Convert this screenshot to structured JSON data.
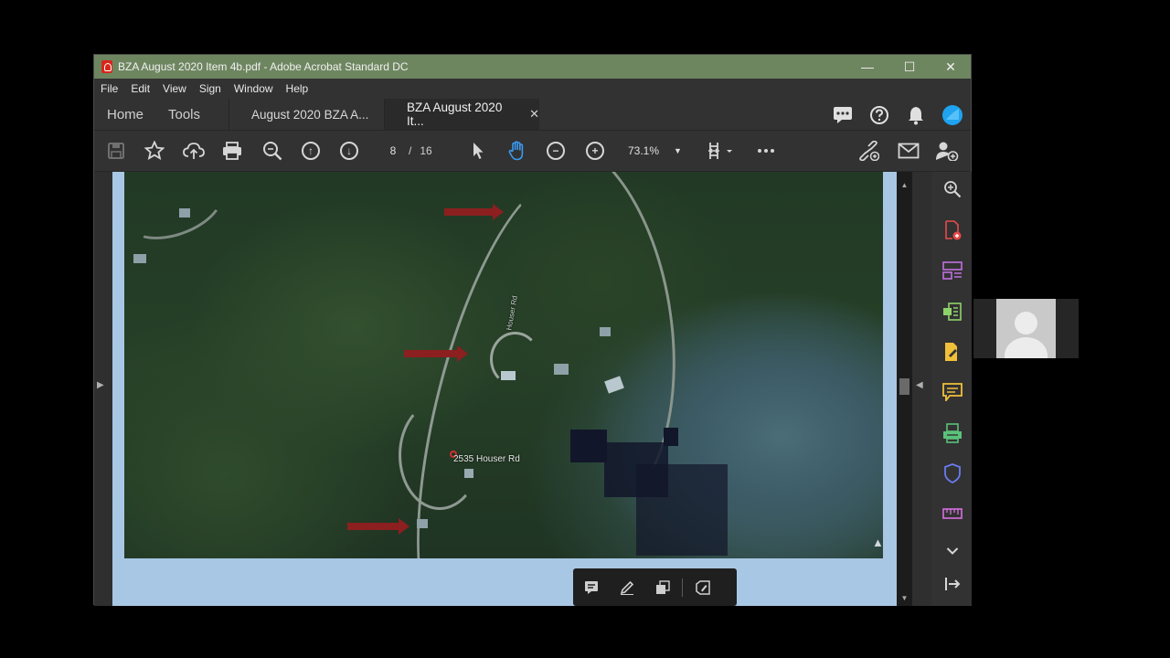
{
  "window": {
    "title": "BZA August 2020 Item 4b.pdf - Adobe Acrobat Standard DC",
    "controls": {
      "minimize": "—",
      "maximize": "☐",
      "close": "✕"
    }
  },
  "menu": [
    "File",
    "Edit",
    "View",
    "Sign",
    "Window",
    "Help"
  ],
  "tabs": {
    "home": "Home",
    "tools": "Tools",
    "documents": [
      {
        "label": "August 2020 BZA A...",
        "active": false
      },
      {
        "label": "BZA August 2020 It...",
        "active": true,
        "close": "✕"
      }
    ]
  },
  "toolbar": {
    "current_page": "8",
    "page_separator": "/",
    "total_pages": "16",
    "zoom": "73.1%"
  },
  "map": {
    "address_label": "2535 Houser Rd",
    "road_label": "Houser Rd"
  },
  "icons": {
    "save": "save-icon",
    "bookmark": "star-icon",
    "upload": "upload-cloud-icon",
    "print": "print-icon",
    "zoom_search": "search-zoom-icon",
    "prev_page": "arrow-up-circle-icon",
    "next_page": "arrow-down-circle-icon",
    "select": "pointer-icon",
    "hand": "hand-icon",
    "zoom_out": "minus-circle-icon",
    "zoom_in": "plus-circle-icon"
  },
  "colors": {
    "titlebar": "#6e8660",
    "accent_blue": "#3a9af0",
    "page_bg": "#a8c7e4"
  }
}
